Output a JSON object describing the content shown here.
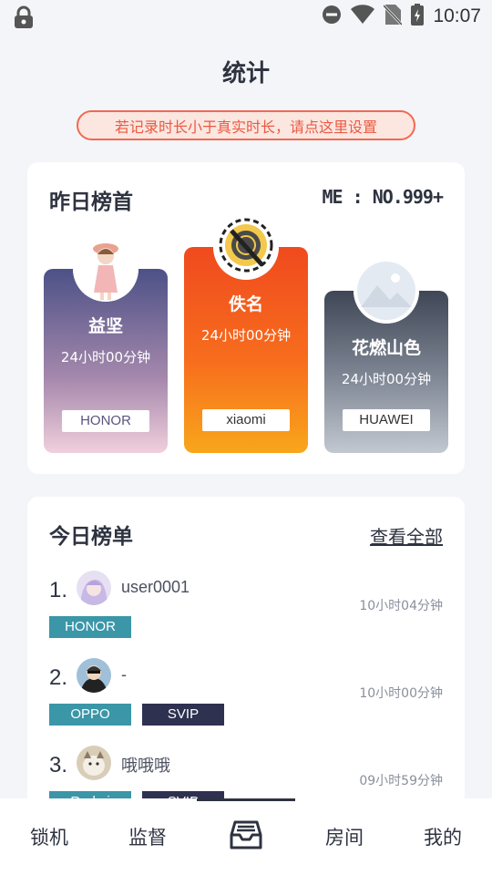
{
  "status_bar": {
    "time": "10:07"
  },
  "page": {
    "title": "统计",
    "hint": "若记录时长小于真实时长，请点这里设置"
  },
  "yesterday": {
    "title": "昨日榜首",
    "me_rank": "ME : NO.999+",
    "podium": [
      {
        "place": 2,
        "name": "益坚",
        "duration": "24小时00分钟",
        "brand": "HONOR"
      },
      {
        "place": 1,
        "name": "佚名",
        "duration": "24小时00分钟",
        "brand": "xiaomi"
      },
      {
        "place": 3,
        "name": "花燃山色",
        "duration": "24小时00分钟",
        "brand": "HUAWEI"
      }
    ]
  },
  "today": {
    "title": "今日榜单",
    "view_all": "查看全部",
    "rows": [
      {
        "rank": "1.",
        "name": "user0001",
        "duration": "10小时04分钟",
        "brand": "HONOR",
        "vip": ""
      },
      {
        "rank": "2.",
        "name": "-",
        "duration": "10小时00分钟",
        "brand": "OPPO",
        "vip": "SVIP"
      },
      {
        "rank": "3.",
        "name": "哦哦哦",
        "duration": "09小时59分钟",
        "brand": "Redmi",
        "vip": "SVIP"
      }
    ]
  },
  "nav": {
    "items": [
      {
        "label": "锁机"
      },
      {
        "label": "监督"
      },
      {
        "label": "",
        "icon": "inbox-icon"
      },
      {
        "label": "房间"
      },
      {
        "label": "我的"
      }
    ],
    "active_index": 2
  },
  "colors": {
    "accent": "#ef6a52",
    "brand_tag": "#3b96a8",
    "vip_tag": "#2e3150"
  }
}
